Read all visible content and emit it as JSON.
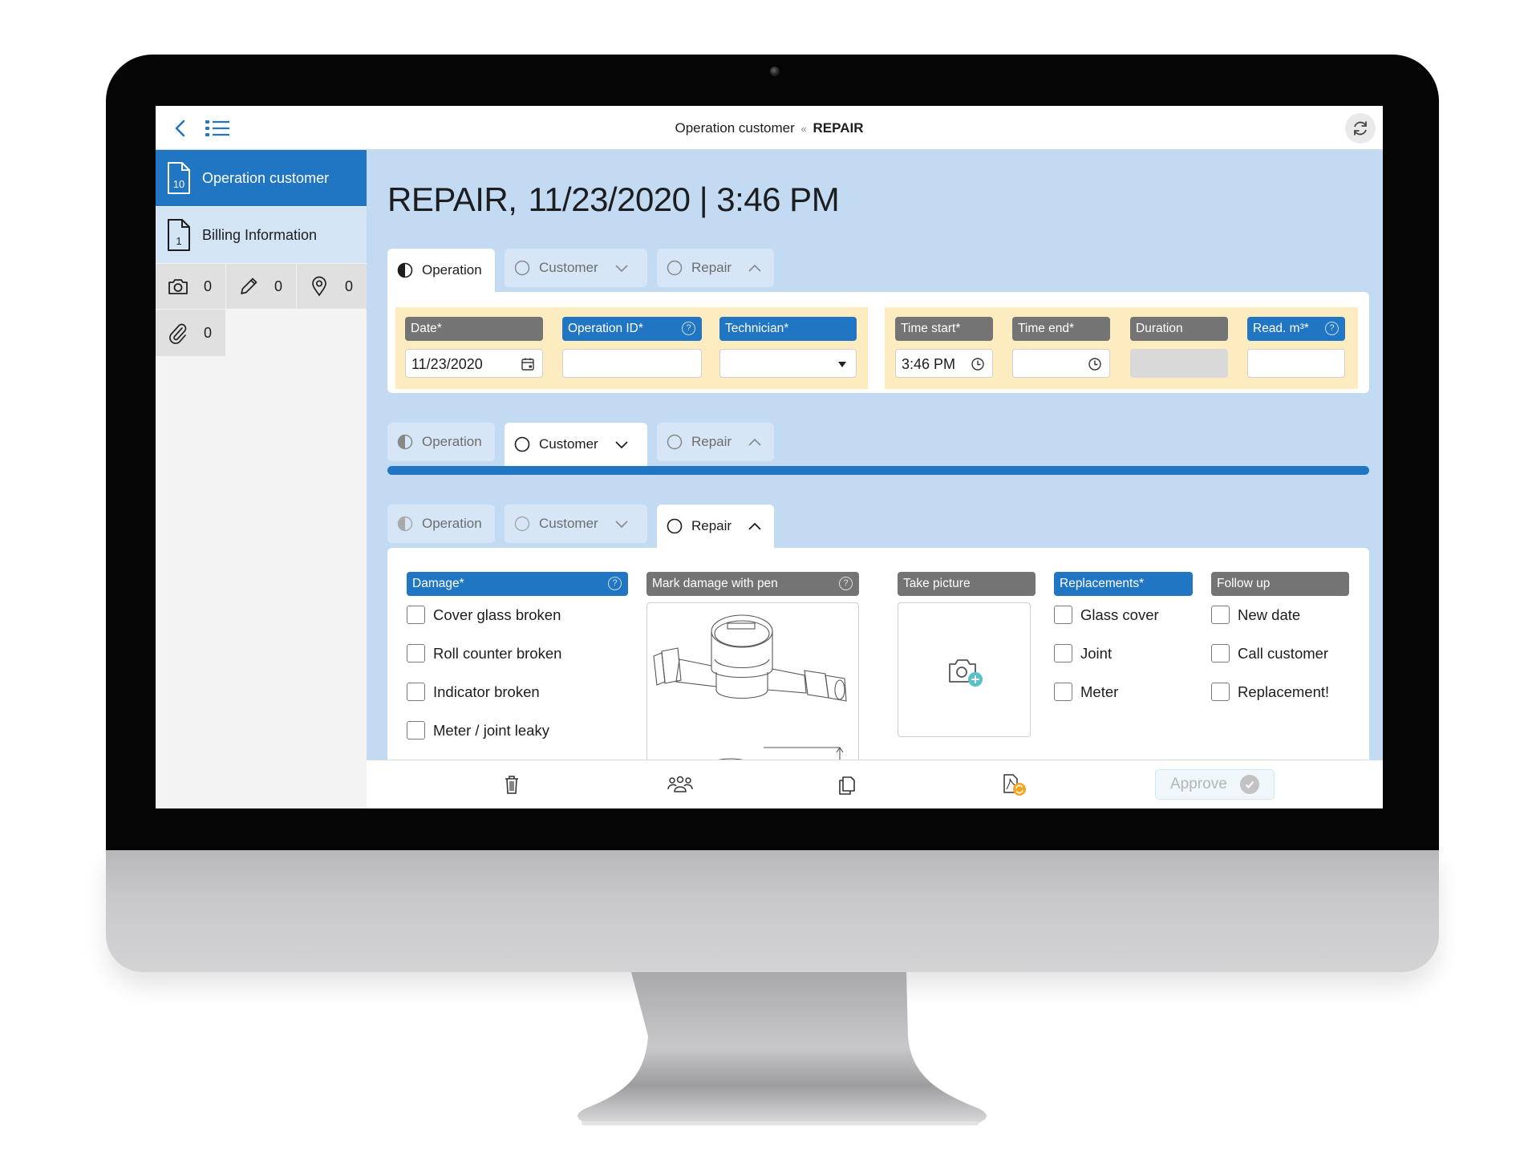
{
  "header": {
    "title_prefix": "Operation customer",
    "title_separator": "«",
    "title_suffix": "REPAIR"
  },
  "sidebar": {
    "items": [
      {
        "label": "Operation customer",
        "count": "10",
        "icon": "document-icon",
        "active": true
      },
      {
        "label": "Billing Information",
        "count": "1",
        "icon": "document-icon",
        "active": false
      }
    ],
    "counters": [
      {
        "icon": "camera-icon",
        "value": "0"
      },
      {
        "icon": "pencil-icon",
        "value": "0"
      },
      {
        "icon": "location-pin-icon",
        "value": "0"
      },
      {
        "icon": "paperclip-icon",
        "value": "0"
      }
    ]
  },
  "page": {
    "title_type": "REPAIR,",
    "title_datetime": "11/23/2020 | 3:46 PM"
  },
  "tabs": {
    "operation": "Operation",
    "customer": "Customer",
    "repair": "Repair"
  },
  "operation_section": {
    "fields": [
      {
        "label": "Date*",
        "value": "11/23/2020",
        "icon": "calendar-icon",
        "style": "gray"
      },
      {
        "label": "Operation ID*",
        "value": "",
        "icon": "help-icon",
        "style": "blue"
      },
      {
        "label": "Technician*",
        "value": "",
        "icon": "dropdown-arrow-icon",
        "style": "blue"
      },
      {
        "label": "Time start*",
        "value": "3:46 PM",
        "icon": "clock-icon",
        "style": "gray"
      },
      {
        "label": "Time end*",
        "value": "",
        "icon": "clock-icon",
        "style": "gray"
      },
      {
        "label": "Duration",
        "value": "",
        "icon": "",
        "style": "gray"
      },
      {
        "label": "Read. m³*",
        "value": "",
        "icon": "help-icon",
        "style": "blue"
      }
    ]
  },
  "customer_section": {
    "progress": 1.0
  },
  "repair_section": {
    "damage": {
      "label": "Damage*",
      "options": [
        "Cover glass broken",
        "Roll counter broken",
        "Indicator broken",
        "Meter / joint leaky"
      ]
    },
    "mark_damage": {
      "label": "Mark damage with pen"
    },
    "take_picture": {
      "label": "Take picture"
    },
    "replacements": {
      "label": "Replacements*",
      "options": [
        "Glass cover",
        "Joint",
        "Meter"
      ]
    },
    "follow_up": {
      "label": "Follow up",
      "options": [
        "New date",
        "Call customer",
        "Replacement!"
      ]
    }
  },
  "bottombar": {
    "approve_label": "Approve"
  },
  "colors": {
    "accent": "#2176c4",
    "content_bg": "#c3dbf2",
    "field_row_bg": "#fdecc0",
    "label_gray": "#747474",
    "badge_orange": "#f5a623",
    "camera_plus": "#5bc0c8"
  }
}
